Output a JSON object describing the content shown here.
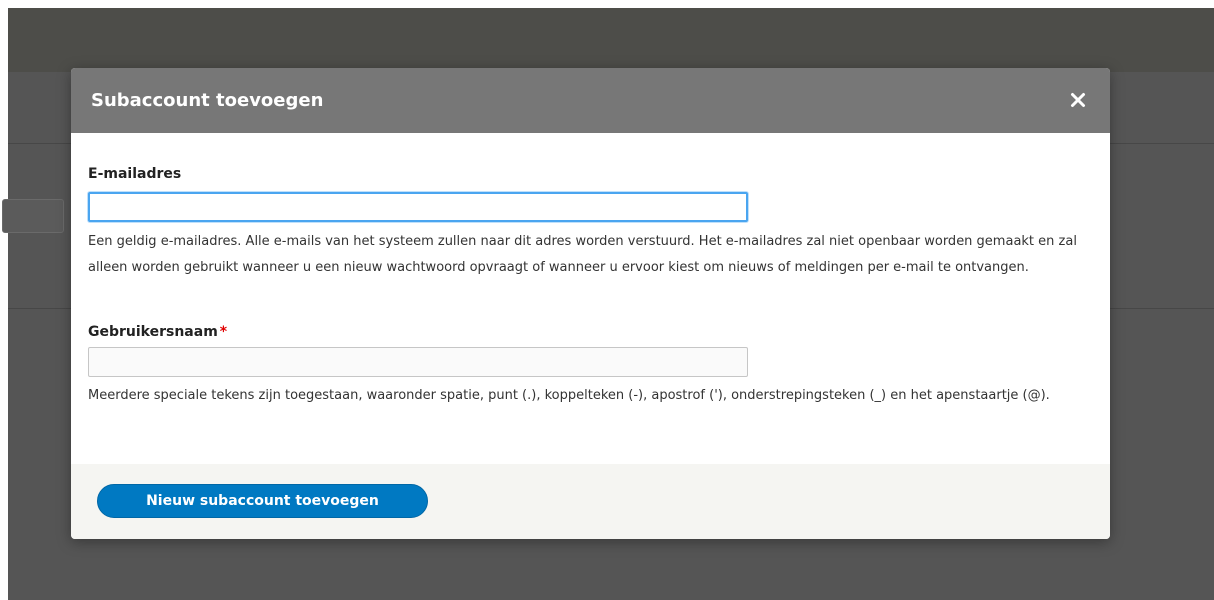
{
  "modal": {
    "title": "Subaccount toevoegen",
    "close_icon": "close-icon"
  },
  "fields": {
    "email": {
      "label": "E-mailadres",
      "value": "",
      "description": "Een geldig e-mailadres. Alle e-mails van het systeem zullen naar dit adres worden verstuurd. Het e-mailadres zal niet openbaar worden gemaakt en zal alleen worden gebruikt wanneer u een nieuw wachtwoord opvraagt of wanneer u ervoor kiest om nieuws of meldingen per e-mail te ontvangen."
    },
    "username": {
      "label": "Gebruikersnaam",
      "required_mark": "*",
      "value": "",
      "description": "Meerdere speciale tekens zijn toegestaan, waaronder spatie, punt (.), koppelteken (-), apostrof ('), onderstrepingsteken (_) en het apenstaartje (@)."
    }
  },
  "footer": {
    "submit_label": "Nieuw subaccount toevoegen"
  },
  "colors": {
    "accent": "#0079c2",
    "header": "#777777",
    "focus": "#4aa5f0",
    "required": "#e00000"
  }
}
